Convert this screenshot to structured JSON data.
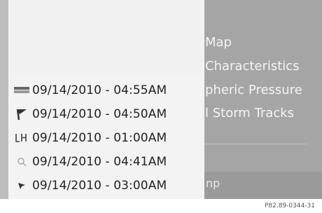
{
  "background_menu": {
    "items": [
      {
        "label": "Map"
      },
      {
        "label": "Characteristics"
      },
      {
        "label": "pheric Pressure"
      },
      {
        "label": "l Storm Tracks"
      }
    ],
    "bottom_label": "np"
  },
  "timestamp_list": [
    {
      "icon": "precipitation-icon",
      "label": "09/14/2010 - 04:55AM"
    },
    {
      "icon": "wind-flag-icon",
      "label": "09/14/2010 - 04:50AM"
    },
    {
      "icon": "pressure-lh-icon",
      "label": "09/14/2010 - 01:00AM"
    },
    {
      "icon": "storm-icon",
      "label": "09/14/2010 - 04:41AM"
    },
    {
      "icon": "track-arrow-icon",
      "label": "09/14/2010 - 03:00AM"
    }
  ],
  "reference_code": "P82.89-0344-31"
}
